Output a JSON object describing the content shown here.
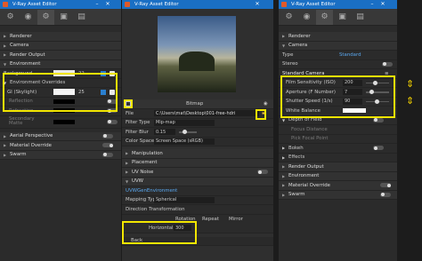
{
  "left": {
    "title": "V-Ray Asset Editor",
    "sections": [
      "Renderer",
      "Camera",
      "Render Output",
      "Environment"
    ],
    "env": {
      "background": "Background",
      "background_value": "22",
      "overrides": "Environment Overrides",
      "gi": "GI (Skylight)",
      "gi_value": "25",
      "reflection": "Reflection",
      "refraction": "Refraction",
      "secondary": "Secondary Matte"
    },
    "lower": [
      "Aerial Perspective",
      "Material Override",
      "Swarm"
    ]
  },
  "middle": {
    "title": "V-Ray Asset Editor",
    "bitmap_label": "Bitmap",
    "file_label": "File",
    "file_path": "C:\\Users\\mat\\Desktop\\001-free-hdri",
    "filter_type": "Filter Type",
    "filter_type_value": "Mip-map",
    "filter_blur": "Filter Blur",
    "filter_blur_value": "0.15",
    "color_space": "Color Space",
    "color_space_value": "Screen Space (sRGB)",
    "sections": [
      "Manipulation",
      "Placement",
      "UV Noise",
      "UVW"
    ],
    "uvw_gen": "UVWGenEnvironment",
    "mapping_type": "Mapping Type",
    "mapping_value": "Spherical",
    "direction": "Direction Transformation",
    "rotation": "Rotation",
    "repeat": "Repeat",
    "mirror": "Mirror",
    "horizontal": "Horizontal",
    "horizontal_value": "300",
    "back": "Back"
  },
  "right": {
    "title": "V-Ray Asset Editor",
    "sections": [
      "Renderer",
      "Camera"
    ],
    "type_label": "Type",
    "type_value": "Standard",
    "stereo": "Stereo",
    "std_camera": "Standard Camera",
    "film": "Film Sensitivity (ISO)",
    "film_value": "200",
    "aperture": "Aperture (F Number)",
    "aperture_value": "7",
    "shutter": "Shutter Speed (1/s)",
    "shutter_value": "90",
    "white_balance": "White Balance",
    "dof": "Depth of Field",
    "focus_distance": "Focus Distance",
    "pick_focal": "Pick Focal Point",
    "bokeh": "Bokeh",
    "effects": "Effects",
    "lower": [
      "Render Output",
      "Environment",
      "Material Override",
      "Swarm"
    ]
  }
}
